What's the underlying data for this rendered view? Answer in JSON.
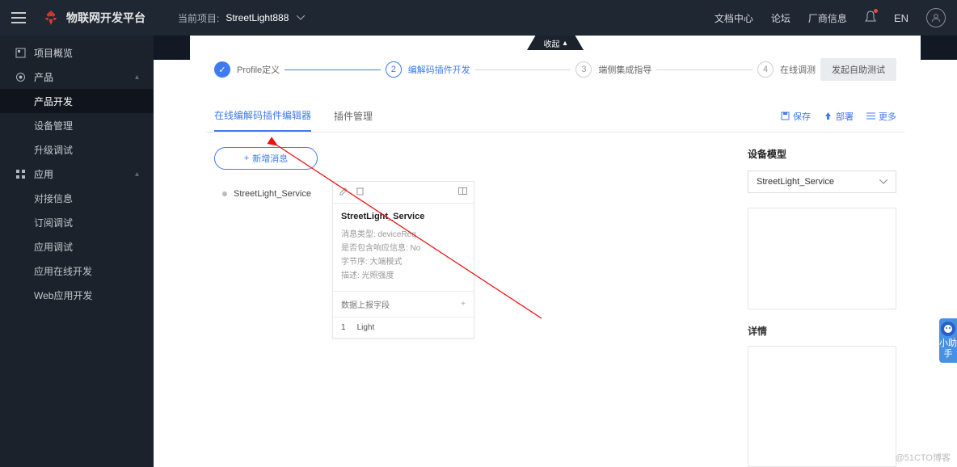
{
  "header": {
    "platform": "物联网开发平台",
    "project_label": "当前项目:",
    "project_name": "StreetLight888",
    "links": {
      "docs": "文档中心",
      "forum": "论坛",
      "vendor": "厂商信息"
    },
    "lang": "EN"
  },
  "sidebar": {
    "overview": "项目概览",
    "product": "产品",
    "product_children": {
      "dev": "产品开发",
      "device": "设备管理",
      "upgrade": "升级调试"
    },
    "app": "应用",
    "app_children": {
      "conn": "对接信息",
      "sub": "订阅调试",
      "appdebug": "应用调试",
      "online": "应用在线开发",
      "web": "Web应用开发"
    }
  },
  "collapse": "收起",
  "steps": {
    "s1": "Profile定义",
    "s2": "编解码插件开发",
    "s3": "端侧集成指导",
    "s4": "在线调测",
    "test_btn": "发起自助测试"
  },
  "tabs": {
    "editor": "在线编解码插件编辑器",
    "manage": "插件管理"
  },
  "tab_actions": {
    "save": "保存",
    "deploy": "部署",
    "more": "更多"
  },
  "add_msg": "新增消息",
  "service_name": "StreetLight_Service",
  "card": {
    "title": "StreetLight_Service",
    "row1": "消息类型: deviceReq",
    "row2": "是否包含响应信息: No",
    "row3": "字节序: 大端模式",
    "row4": "描述: 光照强度",
    "section": "数据上报字段",
    "field_idx": "1",
    "field_name": "Light"
  },
  "right": {
    "model_title": "设备模型",
    "model_select": "StreetLight_Service",
    "detail_title": "详情"
  },
  "helper": "小助手",
  "watermark": "@51CTO博客"
}
